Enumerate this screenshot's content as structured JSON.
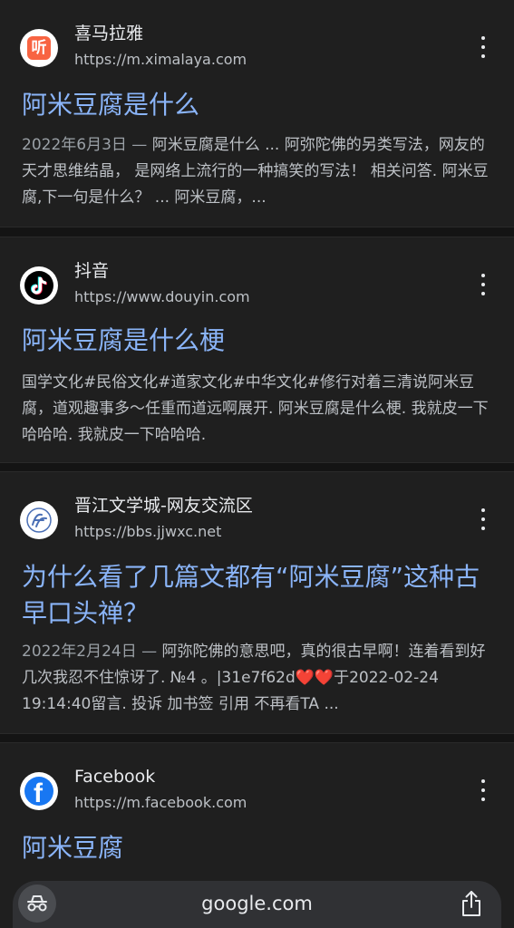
{
  "results": [
    {
      "site_name": "喜马拉雅",
      "url": "https://m.ximalaya.com",
      "favicon": "ximalaya-listen-icon",
      "favicon_glyph": "听",
      "favicon_color": "#f86442",
      "title": "阿米豆腐是什么",
      "date": "2022年6月3日 — ",
      "snippet": "阿米豆腐是什么 ... 阿弥陀佛的另类写法，网友的天才思维结晶， 是网络上流行的一种搞笑的写法！ 相关问答. 阿米豆腐,下一句是什么？ ... 阿米豆腐，..."
    },
    {
      "site_name": "抖音",
      "url": "https://www.douyin.com",
      "favicon": "douyin-note-icon",
      "favicon_color": "#000000",
      "title": "阿米豆腐是什么梗",
      "date": "",
      "snippet": "国学文化#民俗文化#道家文化#中华文化#修行对着三清说阿米豆腐，道观趣事多～任重而道远啊展开. 阿米豆腐是什么梗. 我就皮一下哈哈哈. 我就皮一下哈哈哈."
    },
    {
      "site_name": "晋江文学城-网友交流区",
      "url": "https://bbs.jjwxc.net",
      "favicon": "jjwxc-logo-icon",
      "favicon_color": "#4a6fb5",
      "title": "为什么看了几篇文都有“阿米豆腐”这种古早口头禅？",
      "date": "2022年2月24日 — ",
      "snippet": "阿弥陀佛的意思吧，真的很古早啊！连着看到好几次我忍不住惊讶了. №4 。|31e7f62d❤️❤️于2022-02-24 19:14:40留言. 投诉 加书签 引用 不再看TA ..."
    },
    {
      "site_name": "Facebook",
      "url": "https://m.facebook.com",
      "favicon": "facebook-logo-icon",
      "favicon_color": "#1877f2",
      "title": "阿米豆腐",
      "date": "",
      "snippet": ""
    }
  ],
  "bottom_bar": {
    "domain": "google.com",
    "left_icon": "incognito-icon",
    "right_icon": "share-icon"
  }
}
